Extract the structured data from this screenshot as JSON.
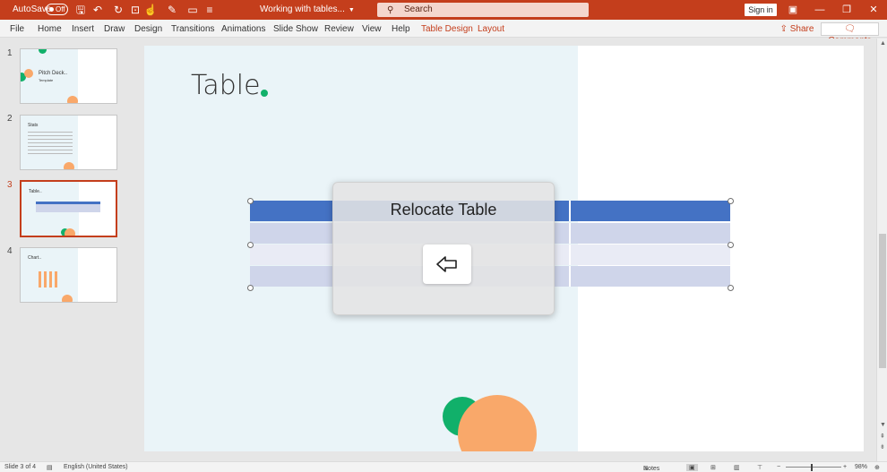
{
  "titlebar": {
    "autosave_label": "AutoSave",
    "autosave_state": "Off",
    "doc_title": "Working with tables...",
    "search_placeholder": "Search",
    "signin_label": "Sign in",
    "accent_color": "#c43e1c"
  },
  "ribbon": {
    "tabs": [
      "File",
      "Home",
      "Insert",
      "Draw",
      "Design",
      "Transitions",
      "Animations",
      "Slide Show",
      "Review",
      "View",
      "Help",
      "Table Design",
      "Layout"
    ],
    "share_label": "Share",
    "comments_label": "Comments"
  },
  "thumbnails": [
    {
      "number": "1",
      "title": "Pitch Deck..",
      "subtitle": "Template"
    },
    {
      "number": "2",
      "title": "Stats"
    },
    {
      "number": "3",
      "title": "Table.."
    },
    {
      "number": "4",
      "title": "Chart.."
    }
  ],
  "active_slide": 3,
  "slide": {
    "title": "Table",
    "table_header_color": "#4472c4",
    "table_row_color_a": "#cfd5ea",
    "table_row_color_b": "#e9ebf5"
  },
  "overlay": {
    "title": "Relocate Table",
    "button_icon": "arrow-left-icon"
  },
  "statusbar": {
    "slide_info": "Slide 3 of 4",
    "language": "English (United States)",
    "notes_label": "Notes",
    "zoom": "98%"
  }
}
